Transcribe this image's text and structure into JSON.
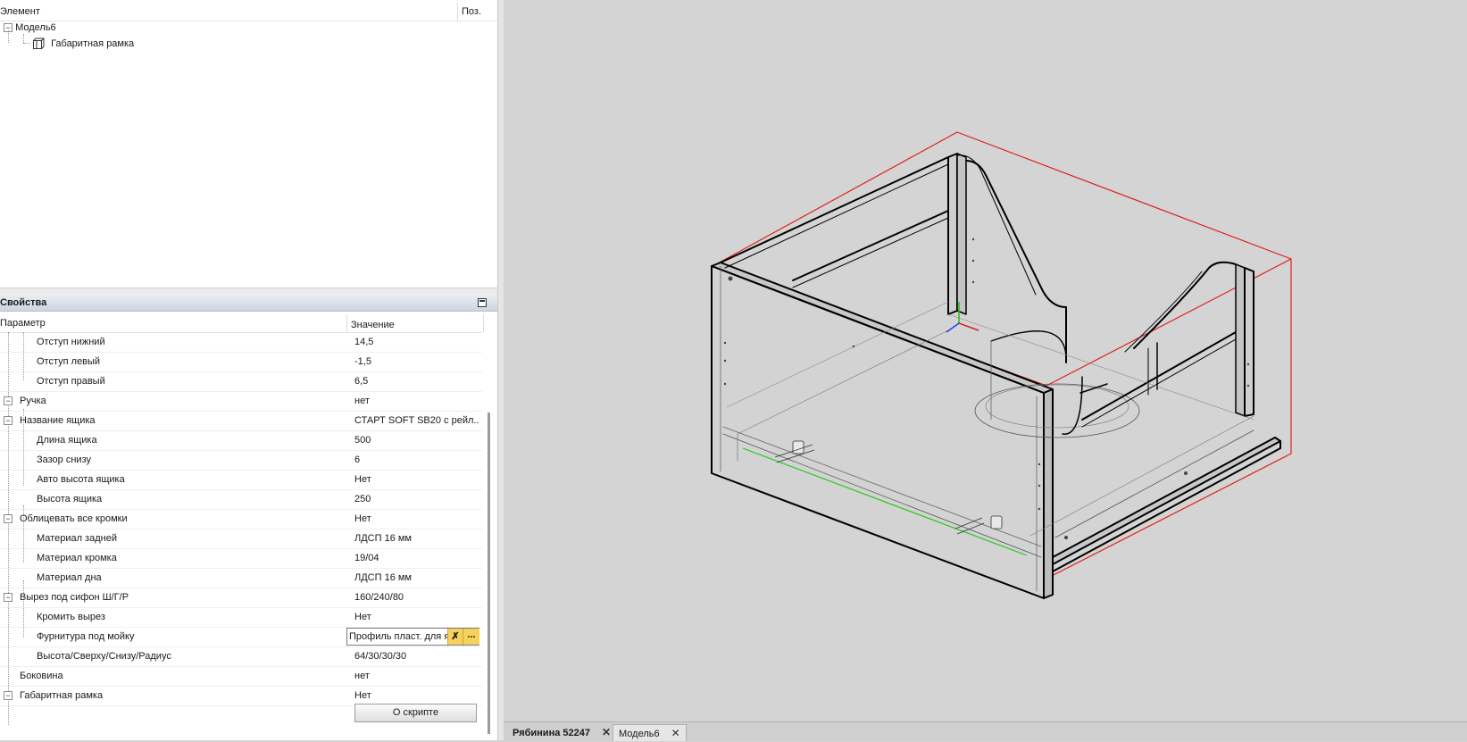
{
  "tree": {
    "header_element": "Элемент",
    "header_pos": "Поз.",
    "root_label": "Модель6",
    "child_label": "Габаритная рамка"
  },
  "properties": {
    "title": "Свойства",
    "col_param": "Параметр",
    "col_value": "Значение",
    "rows": [
      {
        "name": "Отступ нижний",
        "value": "14,5"
      },
      {
        "name": "Отступ левый",
        "value": "-1,5"
      },
      {
        "name": "Отступ правый",
        "value": "6,5"
      },
      {
        "name": "Ручка",
        "value": "нет"
      },
      {
        "name": "Название ящика",
        "value": "СТАРТ SOFT SB20 с рейл..."
      },
      {
        "name": "Длина ящика",
        "value": "500"
      },
      {
        "name": "Зазор снизу",
        "value": "6"
      },
      {
        "name": "Авто высота ящика",
        "value": "Нет"
      },
      {
        "name": "Высота ящика",
        "value": "250"
      },
      {
        "name": "Облицевать все кромки",
        "value": "Нет"
      },
      {
        "name": "Материал задней",
        "value": "ЛДСП 16 мм"
      },
      {
        "name": "Материал кромка",
        "value": "19/04"
      },
      {
        "name": "Материал дна",
        "value": "ЛДСП 16 мм"
      },
      {
        "name": "Вырез под сифон Ш/Г/Р",
        "value": "160/240/80"
      },
      {
        "name": "Кромить вырез",
        "value": "Нет"
      },
      {
        "name": "Фурнитура под мойку",
        "value": "Профиль пласт. для я"
      },
      {
        "name": "Высота/Сверху/Снизу/Радиус",
        "value": "64/30/30/30"
      },
      {
        "name": "Боковина",
        "value": "нет"
      },
      {
        "name": "Габаритная рамка",
        "value": "Нет"
      }
    ],
    "editor_clear": "✗",
    "editor_more": "...",
    "script_button": "О скрипте"
  },
  "tabs": [
    {
      "label": "Рябинина 52247",
      "close": "✕"
    },
    {
      "label": "Модель6",
      "close": "✕"
    }
  ],
  "colors": {
    "bounding_frame": "#e02020",
    "model_lines": "#000000",
    "highlight_edge": "#22cc22"
  }
}
